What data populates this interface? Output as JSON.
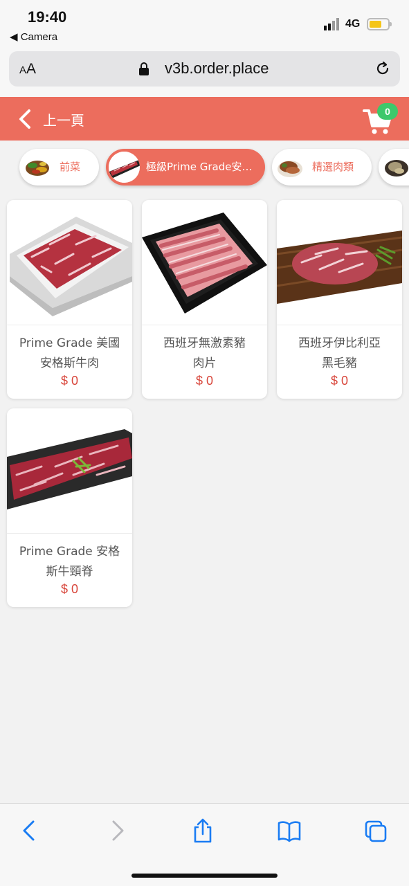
{
  "status_bar": {
    "time": "19:40",
    "back_app": "◀ Camera",
    "network": "4G"
  },
  "browser": {
    "aa_small": "A",
    "aa_big": "A",
    "url": "v3b.order.place"
  },
  "header": {
    "back_label": "上一頁",
    "cart_count": "0"
  },
  "categories": [
    {
      "label": "前菜",
      "active": false
    },
    {
      "label": "極級Prime Grade安…",
      "active": true
    },
    {
      "label": "精選肉類",
      "active": false
    },
    {
      "label": "",
      "active": false
    }
  ],
  "products": [
    {
      "name_line1": "Prime Grade 美國",
      "name_line2": "安格斯牛肉",
      "price": "$ 0"
    },
    {
      "name_line1": "西班牙無激素豬",
      "name_line2": "肉片",
      "price": "$ 0"
    },
    {
      "name_line1": "西班牙伊比利亞",
      "name_line2": "黑毛豬",
      "price": "$ 0"
    },
    {
      "name_line1": "Prime Grade 安格",
      "name_line2": "斯牛頸脊",
      "price": "$ 0"
    }
  ],
  "colors": {
    "brand": "#ec6d5d",
    "badge": "#3ec86b",
    "price": "#d8453a",
    "ios_blue": "#1a7cf3"
  },
  "icons": [
    "chevron-left-icon",
    "cart-icon",
    "lock-icon",
    "reload-icon",
    "back-icon",
    "forward-icon",
    "share-icon",
    "bookmarks-icon",
    "tabs-icon"
  ]
}
